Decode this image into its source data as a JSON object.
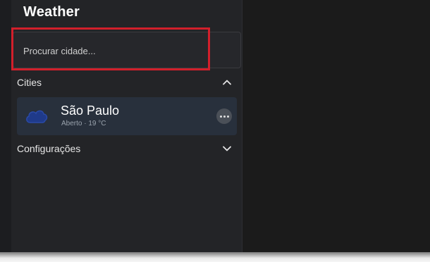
{
  "app": {
    "title": "Weather"
  },
  "search": {
    "placeholder": "Procurar cidade..."
  },
  "sections": {
    "cities": {
      "label": "Cities",
      "expanded": true,
      "items": [
        {
          "name": "São Paulo",
          "meta": "Aberto · 19 °C",
          "icon": "cloud-icon"
        }
      ]
    },
    "settings": {
      "label": "Configurações",
      "expanded": false
    }
  },
  "colors": {
    "highlight": "#d21f2b",
    "card_bg": "#28303c",
    "icon_blue": "#1f3a8a"
  }
}
